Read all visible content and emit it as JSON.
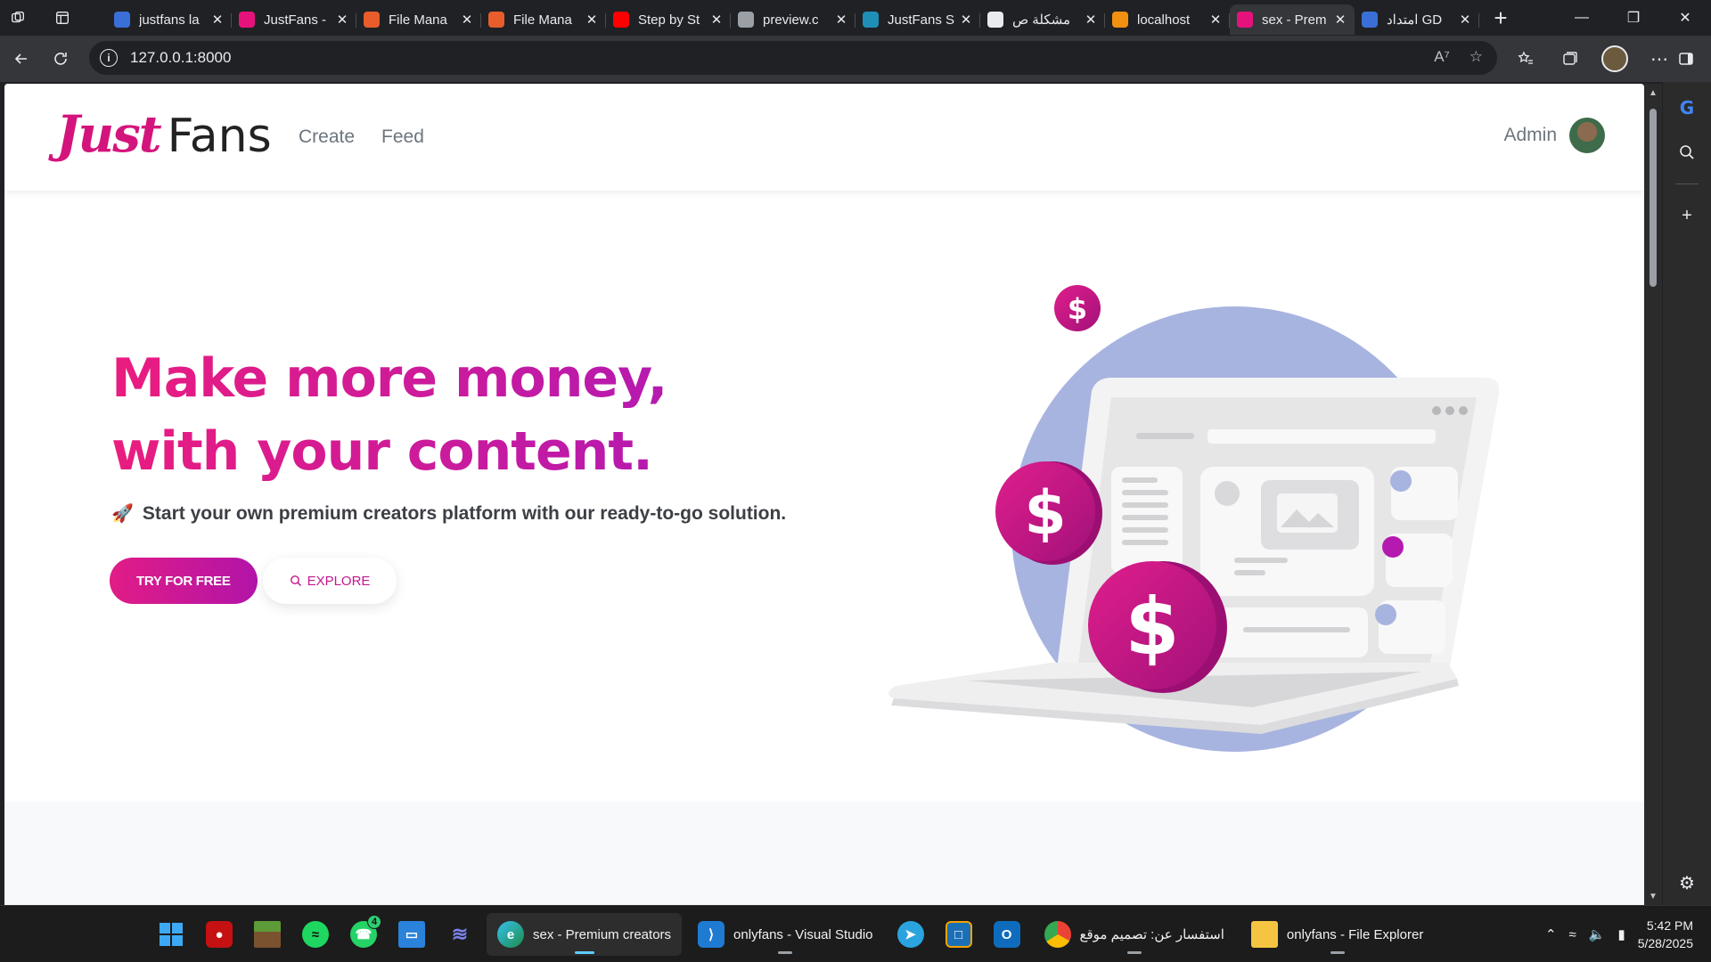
{
  "browser": {
    "tabs": [
      {
        "title": "justfans la",
        "favicon": "search-icon",
        "color": "#3b6fd8"
      },
      {
        "title": "JustFans -",
        "favicon": "justfans-icon",
        "color": "#e6127c"
      },
      {
        "title": "File Mana",
        "favicon": "cpanel-icon",
        "color": "#e85d2b"
      },
      {
        "title": "File Mana",
        "favicon": "cpanel-icon",
        "color": "#e85d2b"
      },
      {
        "title": "Step by St",
        "favicon": "youtube-icon",
        "color": "#ff0000"
      },
      {
        "title": "preview.c",
        "favicon": "file-icon",
        "color": "#9aa0a6"
      },
      {
        "title": "JustFans S",
        "favicon": "globe-icon",
        "color": "#1f8fb8"
      },
      {
        "title": "مشكلة ص",
        "favicon": "openai-icon",
        "color": "#e8eaed"
      },
      {
        "title": "localhost",
        "favicon": "xampp-icon",
        "color": "#f29111"
      },
      {
        "title": "sex - Prem",
        "favicon": "justfans-icon",
        "color": "#e6127c",
        "active": true
      },
      {
        "title": "امتداد GD",
        "favicon": "search-icon",
        "color": "#3b6fd8"
      }
    ],
    "url": "127.0.0.1:8000"
  },
  "site": {
    "logo_part1": "Just",
    "logo_part2": "Fans",
    "nav": [
      "Create",
      "Feed"
    ],
    "user_name": "Admin"
  },
  "hero": {
    "title_line1": "Make more money,",
    "title_line2": "with your content.",
    "subtitle": "Start your own premium creators platform with our ready-to-go solution.",
    "subtitle_icon": "rocket-icon",
    "cta_primary": "TRY FOR FREE",
    "cta_secondary": "EXPLORE"
  },
  "colors": {
    "brand_pink": "#e6127c",
    "brand_purple": "#b51ab0",
    "illustration_circle": "#a8b4e0"
  },
  "taskbar": {
    "items": [
      {
        "label": "sex - Premium creators",
        "icon": "edge-icon",
        "active": true
      },
      {
        "label": "onlyfans - Visual Studio",
        "icon": "vscode-icon"
      },
      {
        "label": "استفسار عن: تصميم موقع",
        "icon": "chrome-icon"
      },
      {
        "label": "onlyfans - File Explorer",
        "icon": "folder-icon"
      }
    ],
    "whatsapp_badge": "4",
    "time": "5:42 PM",
    "date": "5/28/2025"
  }
}
